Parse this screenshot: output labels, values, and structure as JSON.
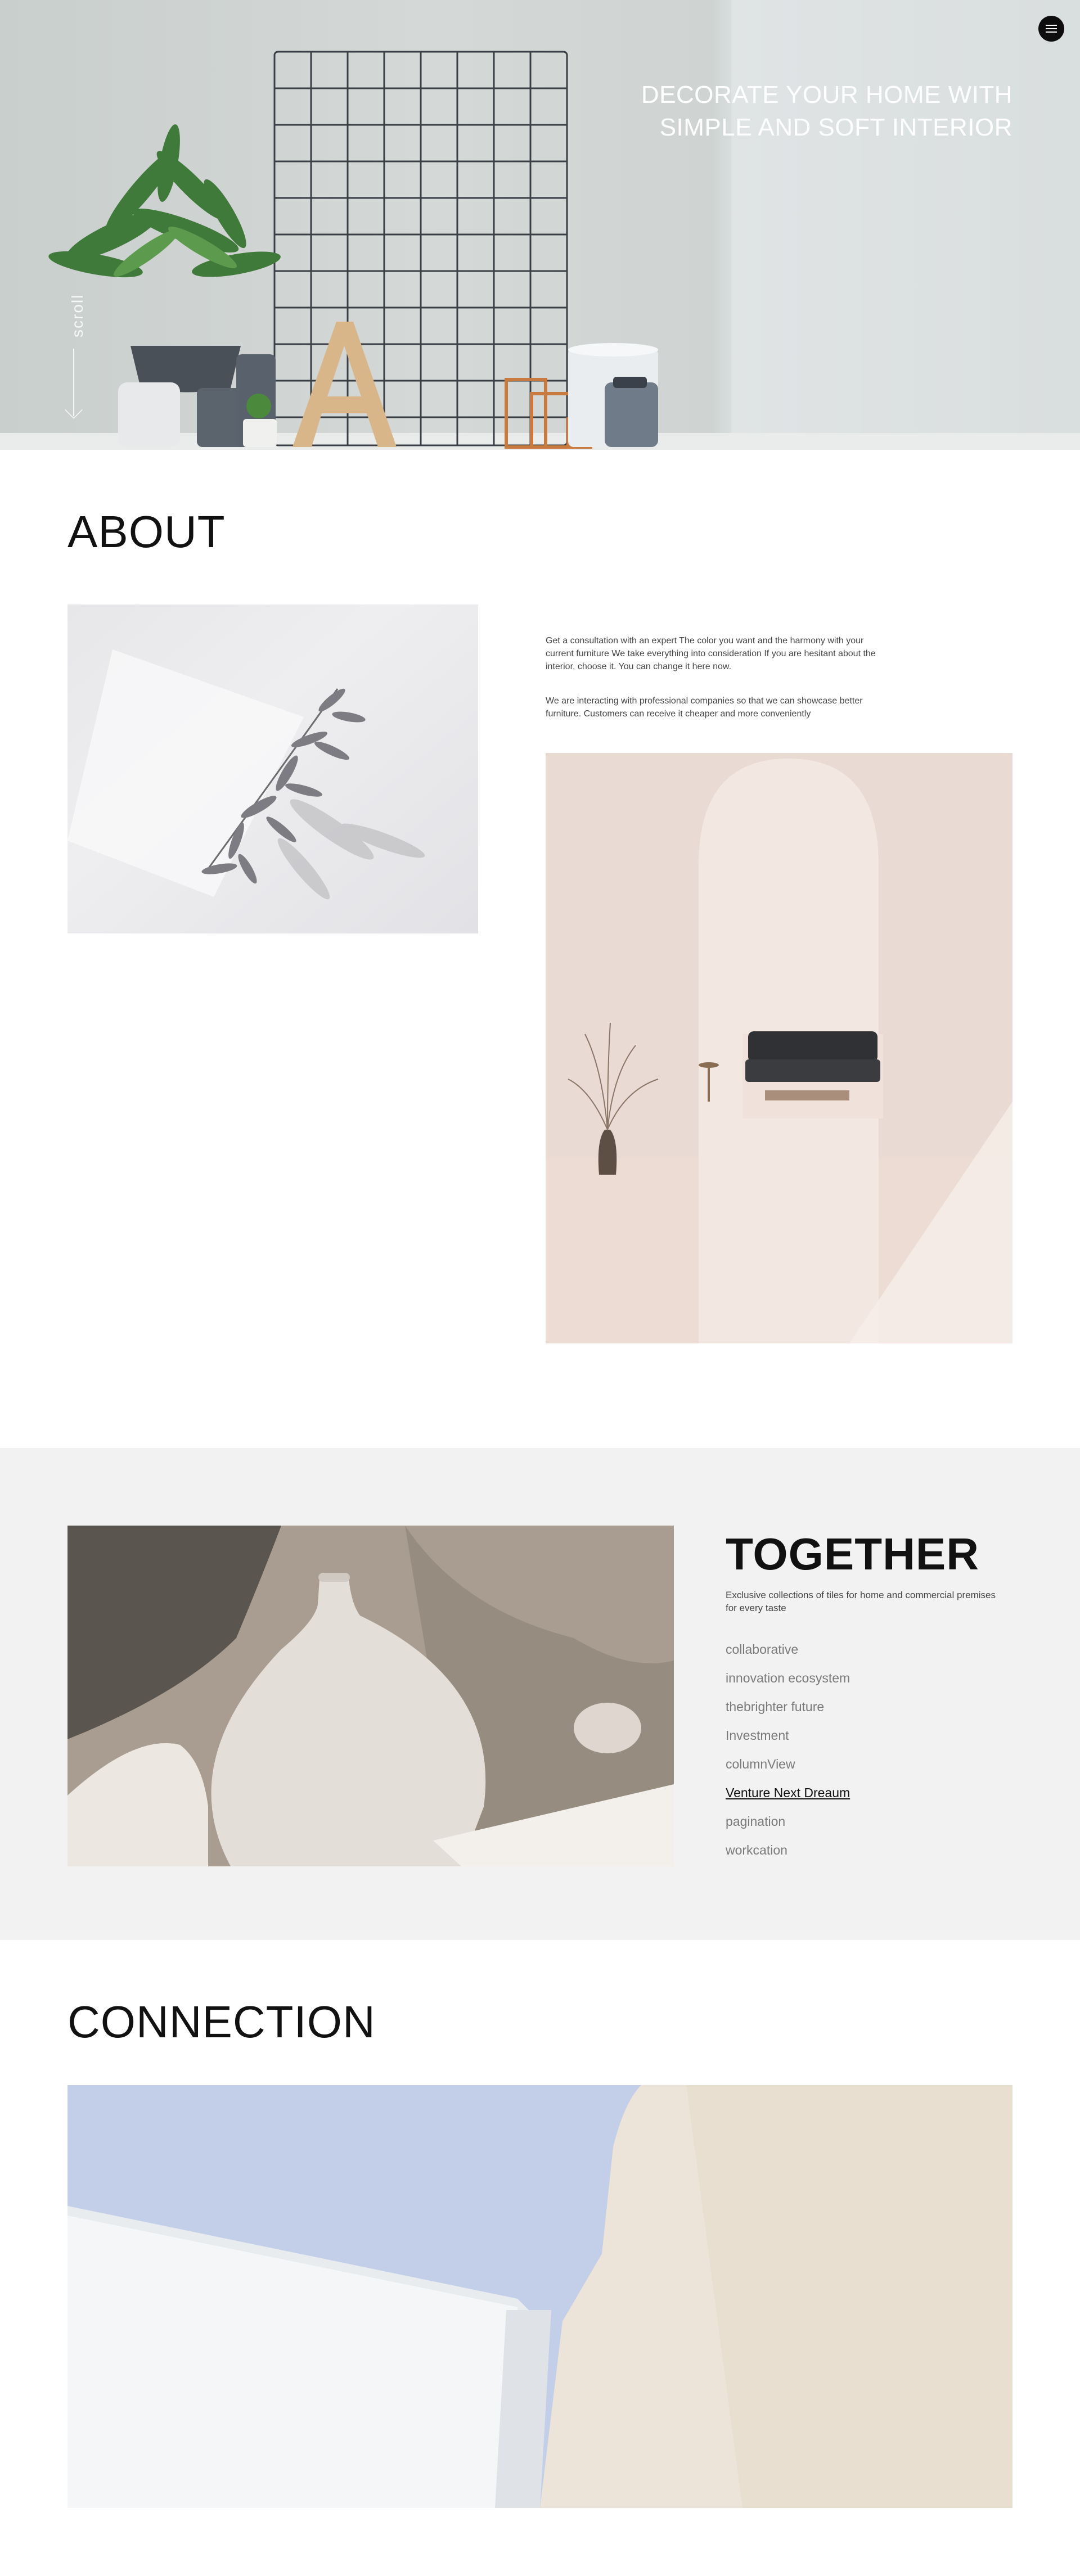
{
  "hero": {
    "title_line1": "DECORATE YOUR HOME WITH",
    "title_line2": "SIMPLE AND SOFT INTERIOR",
    "scroll_label": "scroll",
    "menu_icon": "hamburger-menu-icon"
  },
  "about": {
    "title": "ABOUT",
    "paragraph1": "Get a consultation with an expert The color you want and the harmony with your current furniture We take everything into consideration If you are hesitant about the interior, choose it. You can change it here now.",
    "paragraph2": "We are interacting with professional companies so that we can showcase better furniture. Customers can receive it cheaper and more conveniently"
  },
  "together": {
    "title": "TOGETHER",
    "description": "Exclusive collections of tiles for home and commercial premises for every taste",
    "links": [
      {
        "label": "collaborative"
      },
      {
        "label": "innovation ecosystem"
      },
      {
        "label": "thebrighter future"
      },
      {
        "label": "Investment"
      },
      {
        "label": "columnView"
      },
      {
        "label": "Venture Next Dreaum"
      },
      {
        "label": "pagination"
      },
      {
        "label": "workcation"
      }
    ],
    "active_index": 5
  },
  "connection": {
    "title": "CONNECTION"
  },
  "colors": {
    "section_bg": "#f2f2f2",
    "text_dark": "#111111",
    "link_muted": "#7a7a7a"
  }
}
